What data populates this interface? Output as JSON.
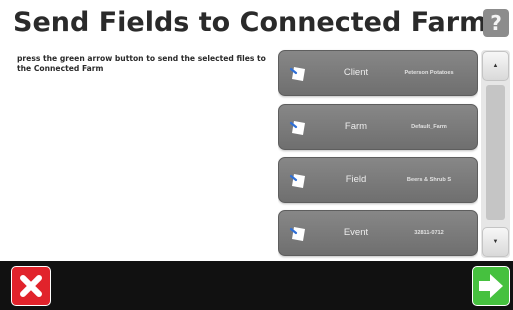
{
  "header": {
    "title": "Send Fields to Connected Farm",
    "help_label": "?"
  },
  "instructions": "press the green arrow button to send the selected files to the Connected Farm",
  "rows": [
    {
      "label": "Client",
      "value": "Peterson Potatoes",
      "icon": "document-icon"
    },
    {
      "label": "Farm",
      "value": "Default_Farm",
      "icon": "document-icon"
    },
    {
      "label": "Field",
      "value": "Beers & Shrub S",
      "icon": "document-icon"
    },
    {
      "label": "Event",
      "value": "32811-0712",
      "icon": "document-icon"
    }
  ],
  "scrollbar": {
    "up_icon": "arrow-up-icon",
    "down_icon": "arrow-down-icon"
  },
  "footer": {
    "cancel_icon": "close-icon",
    "send_icon": "arrow-right-icon"
  },
  "colors": {
    "cancel": "#e1232b",
    "send": "#46c13f",
    "row": "#7a7a7a",
    "bottom_bar": "#111111"
  }
}
